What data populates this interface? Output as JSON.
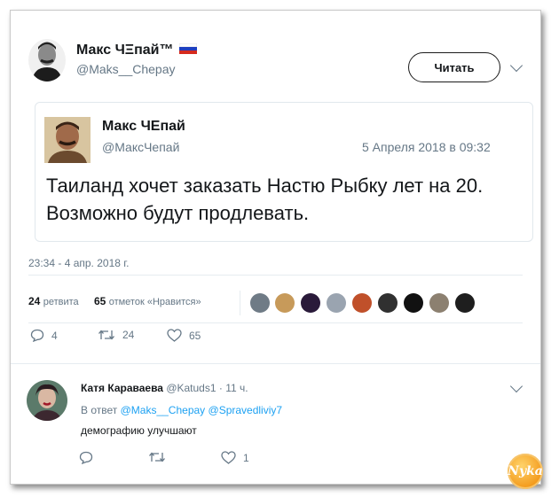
{
  "tweet": {
    "author_name": "Макс ЧΞпай™",
    "flag": "ru-flag",
    "author_handle": "@Maks__Chepay",
    "follow_label": "Читать",
    "timestamp": "23:34 - 4 апр. 2018 г.",
    "retweets_count": "24",
    "retweets_label": "ретвита",
    "likes_count": "65",
    "likes_label": "отметок «Нравится»",
    "actions": {
      "replies": "4",
      "retweets": "24",
      "likes": "65"
    }
  },
  "quoted": {
    "author_name": "Макс ЧЕпай",
    "author_handle": "@МаксЧепай",
    "date": "5 Апреля 2018 в 09:32",
    "text": "Таиланд хочет заказать Настю Рыбку лет на 20. Возможно будут продлевать."
  },
  "reply": {
    "author_name": "Катя Караваева",
    "author_handle": "@Katuds1",
    "time": "· 11 ч.",
    "in_reply_prefix": "В ответ",
    "mention1": "@Maks__Chepay",
    "mention2": "@Spravedliviy7",
    "text": "демографию улучшают",
    "actions": {
      "replies": "",
      "retweets": "",
      "likes": "1"
    }
  },
  "watermark": "Nyka",
  "colors": {
    "link": "#1da1f2",
    "muted": "#657786",
    "border": "#e1e8ed"
  }
}
